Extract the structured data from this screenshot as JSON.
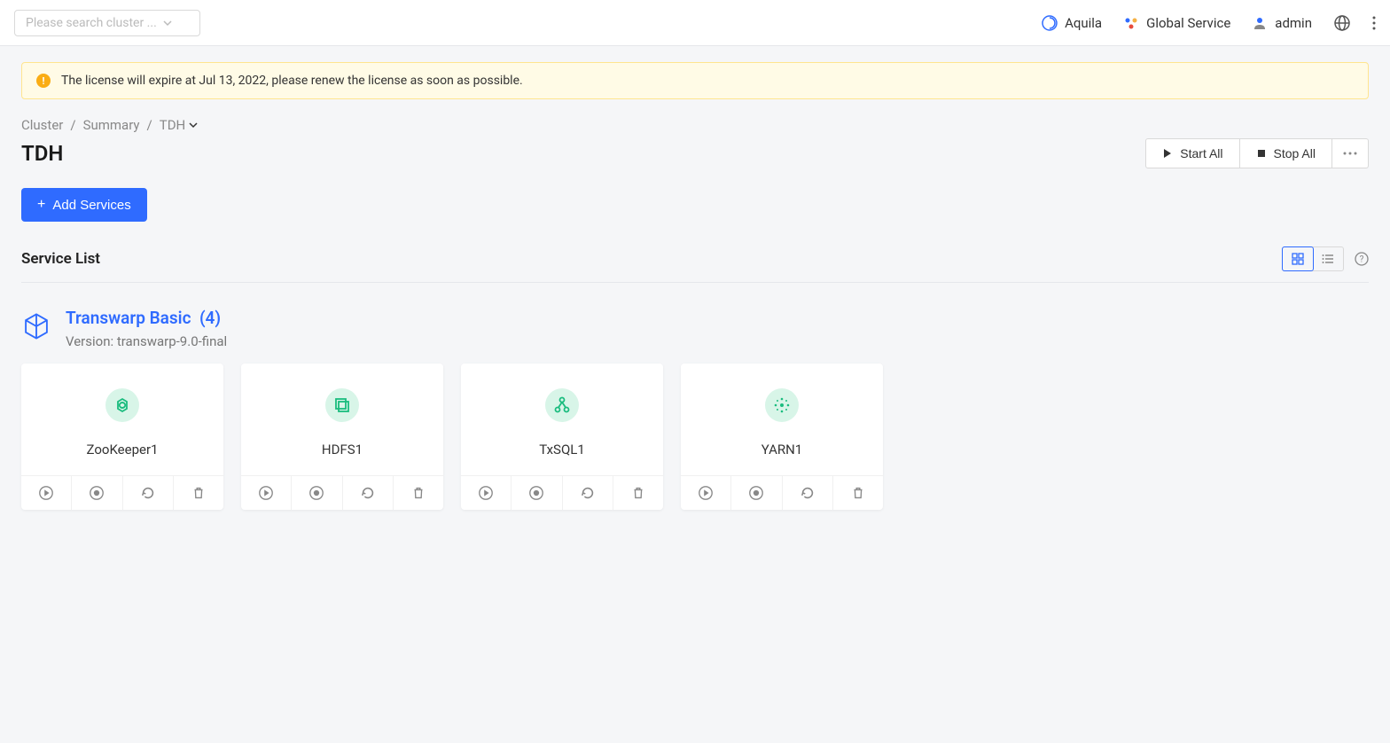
{
  "header": {
    "search_placeholder": "Please search cluster ...",
    "aquila": "Aquila",
    "global_service": "Global Service",
    "user": "admin"
  },
  "alert": {
    "text": "The license will expire at Jul 13, 2022, please renew the license as soon as possible."
  },
  "breadcrumb": {
    "cluster": "Cluster",
    "summary": "Summary",
    "current": "TDH"
  },
  "page": {
    "title": "TDH",
    "start_all": "Start All",
    "stop_all": "Stop All",
    "add_services": "Add Services",
    "service_list": "Service List"
  },
  "group": {
    "title": "Transwarp Basic",
    "count": "(4)",
    "version_label": "Version: transwarp-9.0-final"
  },
  "services": [
    {
      "name": "ZooKeeper1",
      "icon": "cycle"
    },
    {
      "name": "HDFS1",
      "icon": "stack"
    },
    {
      "name": "TxSQL1",
      "icon": "tree"
    },
    {
      "name": "YARN1",
      "icon": "dots"
    }
  ]
}
